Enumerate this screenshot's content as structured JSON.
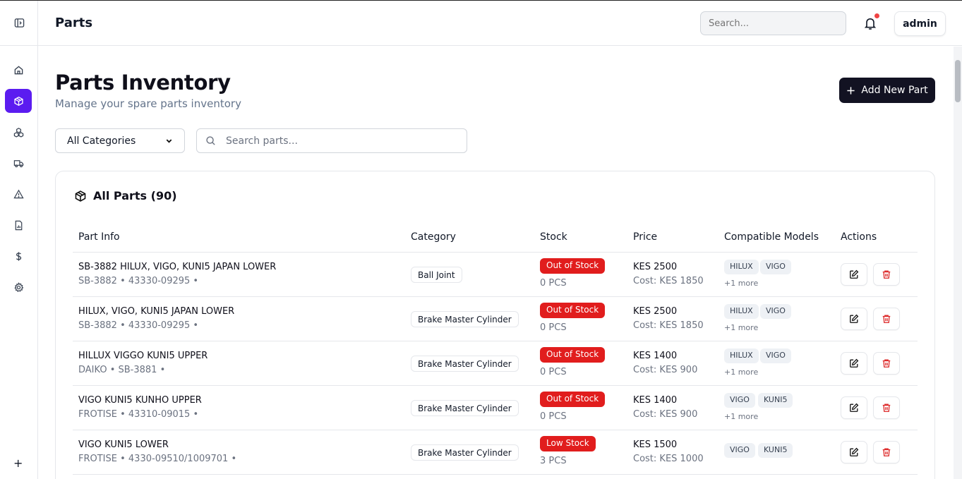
{
  "header": {
    "title": "Parts",
    "search_placeholder": "Search...",
    "user": "admin"
  },
  "sidebar": {
    "items": [
      {
        "icon": "home-icon"
      },
      {
        "icon": "package-icon",
        "active": true
      },
      {
        "icon": "boxes-icon"
      },
      {
        "icon": "truck-icon"
      },
      {
        "icon": "alert-triangle-icon"
      },
      {
        "icon": "report-icon"
      },
      {
        "icon": "dollar-icon"
      },
      {
        "icon": "settings-icon"
      }
    ],
    "add_label": "+"
  },
  "page": {
    "title": "Parts Inventory",
    "subtitle": "Manage your spare parts inventory",
    "add_button": "Add New Part",
    "category_filter": "All Categories",
    "search_placeholder": "Search parts..."
  },
  "table": {
    "title": "All Parts (90)",
    "columns": [
      "Part Info",
      "Category",
      "Stock",
      "Price",
      "Compatible Models",
      "Actions"
    ],
    "rows": [
      {
        "name": "SB-3882 HILUX, VIGO, KUNI5 JAPAN LOWER",
        "meta": "SB-3882 • 43330-09295 •",
        "category": "Ball Joint",
        "stock_status": "Out of Stock",
        "stock_qty": "0 PCS",
        "price": "KES 2500",
        "cost": "Cost: KES 1850",
        "models": [
          "HILUX",
          "VIGO"
        ],
        "more": "+1 more"
      },
      {
        "name": "HILUX, VIGO, KUNI5 JAPAN LOWER",
        "meta": "SB-3882 • 43330-09295 •",
        "category": "Brake Master Cylinder",
        "stock_status": "Out of Stock",
        "stock_qty": "0 PCS",
        "price": "KES 2500",
        "cost": "Cost: KES 1850",
        "models": [
          "HILUX",
          "VIGO"
        ],
        "more": "+1 more"
      },
      {
        "name": "HILLUX VIGGO KUNI5 UPPER",
        "meta": "DAIKO • SB-3881 •",
        "category": "Brake Master Cylinder",
        "stock_status": "Out of Stock",
        "stock_qty": "0 PCS",
        "price": "KES 1400",
        "cost": "Cost: KES 900",
        "models": [
          "HILUX",
          "VIGO"
        ],
        "more": "+1 more"
      },
      {
        "name": "VIGO KUNI5 KUNHO UPPER",
        "meta": "FROTISE • 43310-09015 •",
        "category": "Brake Master Cylinder",
        "stock_status": "Out of Stock",
        "stock_qty": "0 PCS",
        "price": "KES 1400",
        "cost": "Cost: KES 900",
        "models": [
          "VIGO",
          "KUNI5"
        ],
        "more": "+1 more"
      },
      {
        "name": "VIGO KUNI5 LOWER",
        "meta": "FROTISE • 4330-09510/1009701 •",
        "category": "Brake Master Cylinder",
        "stock_status": "Low Stock",
        "stock_qty": "3 PCS",
        "price": "KES 1500",
        "cost": "Cost: KES 1000",
        "models": [
          "VIGO",
          "KUNI5"
        ],
        "more": ""
      }
    ]
  },
  "colors": {
    "accent": "#5b1cf0",
    "danger": "#e11d1d",
    "dark": "#121222"
  }
}
